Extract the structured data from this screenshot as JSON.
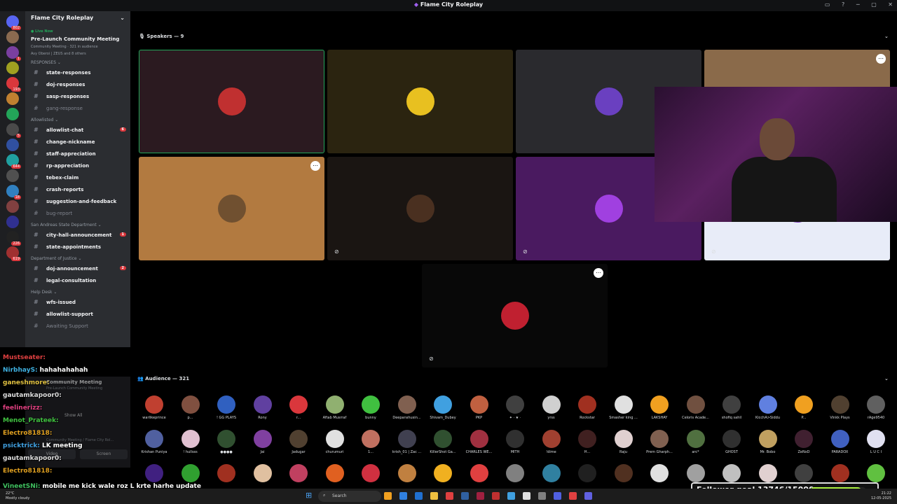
{
  "window": {
    "title": "Flame City Roleplay",
    "controls": [
      "▭",
      "?",
      "─",
      "▢",
      "✕"
    ]
  },
  "guilds": [
    {
      "color": "#5865f2",
      "badge": "802"
    },
    {
      "color": "#8a6a50",
      "badge": ""
    },
    {
      "color": "#7a3fa0",
      "badge": "1"
    },
    {
      "color": "#a0a020",
      "badge": ""
    },
    {
      "color": "#da373c",
      "badge": "193"
    },
    {
      "color": "#c08030",
      "badge": ""
    },
    {
      "color": "#23a559",
      "badge": ""
    },
    {
      "color": "#4a4a4a",
      "badge": "5"
    },
    {
      "color": "#3050a0",
      "badge": ""
    },
    {
      "color": "#20a0a0",
      "badge": "644"
    },
    {
      "color": "#505050",
      "badge": ""
    },
    {
      "color": "#3080c0",
      "badge": "18"
    },
    {
      "color": "#804040",
      "badge": ""
    },
    {
      "color": "#303090",
      "badge": ""
    },
    {
      "color": "#222",
      "badge": "226"
    },
    {
      "color": "#a03030",
      "badge": "619"
    }
  ],
  "server": {
    "name": "Flame City Roleplay",
    "event": {
      "live_label": "Live Now",
      "title": "Pre-Launch Community Meeting",
      "meta": "Community Meeting · 321 in audience",
      "speakers": "Avy Oberoi | ZEUS and 8 others"
    }
  },
  "categories": [
    {
      "name": "RESPONSES",
      "channels": [
        {
          "name": "state-responses",
          "muted": false,
          "count": ""
        },
        {
          "name": "doj-responses",
          "muted": false,
          "count": ""
        },
        {
          "name": "sasp-responses",
          "muted": false,
          "count": ""
        },
        {
          "name": "gang-response",
          "muted": true,
          "count": ""
        }
      ]
    },
    {
      "name": "Allowlisted",
      "channels": [
        {
          "name": "allowlist-chat",
          "muted": false,
          "count": "6"
        },
        {
          "name": "change-nickname",
          "muted": false,
          "count": ""
        },
        {
          "name": "staff-appreciation",
          "muted": false,
          "count": ""
        },
        {
          "name": "rp-appreciation",
          "muted": false,
          "count": ""
        },
        {
          "name": "tebex-claim",
          "muted": false,
          "count": ""
        },
        {
          "name": "crash-reports",
          "muted": false,
          "count": ""
        },
        {
          "name": "suggestion-and-feedback",
          "muted": false,
          "count": ""
        },
        {
          "name": "bug-report",
          "muted": true,
          "count": ""
        }
      ]
    },
    {
      "name": "San Andreas State Department",
      "channels": [
        {
          "name": "city-hall-announcement",
          "muted": false,
          "count": "1"
        },
        {
          "name": "state-appointments",
          "muted": false,
          "count": ""
        }
      ]
    },
    {
      "name": "Department of Justice",
      "channels": [
        {
          "name": "doj-announcement",
          "muted": false,
          "count": "2"
        },
        {
          "name": "legal-consultation",
          "muted": false,
          "count": ""
        }
      ]
    },
    {
      "name": "Help Desk",
      "channels": [
        {
          "name": "wfs-issued",
          "muted": false,
          "count": ""
        },
        {
          "name": "allowlist-support",
          "muted": false,
          "count": ""
        },
        {
          "name": "Awaiting Support",
          "muted": true,
          "count": ""
        }
      ]
    }
  ],
  "chat": [
    {
      "user": "Mustseater:",
      "text": "",
      "color": "#e04040"
    },
    {
      "user": "NirbhayS:",
      "text": "hahahahahah",
      "color": "#3fb0e0"
    },
    {
      "user": "ganeshmore:",
      "text": "",
      "color": "#e0c040"
    },
    {
      "user": "gautamkapoor0:",
      "text": "",
      "color": "#ddd"
    },
    {
      "user": "feelinerizz:",
      "text": "",
      "color": "#e04080"
    },
    {
      "user": "Menot_Prateek:",
      "text": "",
      "color": "#40c040"
    },
    {
      "user": "Electro81818:",
      "text": "",
      "color": "#e0a020"
    },
    {
      "user": "psicktrick:",
      "text": "LK meeting",
      "color": "#40a0e0"
    },
    {
      "user": "gautamkapoor0:",
      "text": "",
      "color": "#ddd"
    },
    {
      "user": "Electro81818:",
      "text": "",
      "color": "#e0a020"
    },
    {
      "user": "VineetSNi:",
      "text": "mobile me kick wale roz L krte harhe update",
      "color": "#40c060"
    }
  ],
  "voice_panel": {
    "title": "Community Meeting",
    "subtitle": "Pre-Launch Community Meeting",
    "show_all": "Show All",
    "location": "Community Meeting / Flame City Rol...",
    "video": "Video",
    "screen": "Screen"
  },
  "stage": {
    "speakers_label": "Speakers — 9",
    "audience_label": "Audience — 321",
    "speakers": [
      {
        "bg": "#2b1a20",
        "av": "#c03030",
        "border": "#23a559",
        "muted": false,
        "opt": false
      },
      {
        "bg": "#2b2410",
        "av": "#e8c020",
        "border": "",
        "muted": false,
        "opt": false
      },
      {
        "bg": "#2a2a2e",
        "av": "#6a40c0",
        "border": "",
        "muted": false,
        "opt": false
      },
      {
        "bg": "#8a6a4a",
        "av": "#8a6a4a",
        "border": "",
        "muted": false,
        "opt": true
      },
      {
        "bg": "#b27a40",
        "av": "#705030",
        "border": "",
        "muted": false,
        "opt": true
      },
      {
        "bg": "#1a1512",
        "av": "#4a3020",
        "border": "",
        "muted": true,
        "opt": false
      },
      {
        "bg": "#4a1a60",
        "av": "#a040e0",
        "border": "",
        "muted": true,
        "opt": false
      },
      {
        "bg": "#e8ecf8",
        "av": "#8040c0",
        "border": "",
        "muted": true,
        "opt": false
      },
      {
        "bg": "#080808",
        "av": "#c02030",
        "border": "",
        "muted": true,
        "opt": true
      }
    ]
  },
  "audience": [
    {
      "name": "warlikeprince",
      "color": "#c04030"
    },
    {
      "name": "p...",
      "color": "#805040"
    },
    {
      "name": "! GG PLAYS",
      "color": "#3060c0"
    },
    {
      "name": "Rony",
      "color": "#6040a0"
    },
    {
      "name": "r...",
      "color": "#da373c"
    },
    {
      "name": "Aftab Musrraf",
      "color": "#90b070"
    },
    {
      "name": "bunny",
      "color": "#40c040"
    },
    {
      "name": "Deepanshusin...",
      "color": "#806050"
    },
    {
      "name": "Shivam_Dubey",
      "color": "#40a0e0"
    },
    {
      "name": "PKP",
      "color": "#c06040"
    },
    {
      "name": "✦ · ★ ·",
      "color": "#404040"
    },
    {
      "name": "yrss",
      "color": "#d0d0d0"
    },
    {
      "name": "Rockstar",
      "color": "#a03020"
    },
    {
      "name": "Smasher king ...",
      "color": "#e0e0e0"
    },
    {
      "name": "LAKSHAY",
      "color": "#f0a020"
    },
    {
      "name": "Celoris Acade...",
      "color": "#705040"
    },
    {
      "name": "shofiq sahil",
      "color": "#404040"
    },
    {
      "name": "KicchA>Siddu",
      "color": "#6080e0"
    },
    {
      "name": "P...",
      "color": "#f0a020"
    },
    {
      "name": "Vinkk Plays",
      "color": "#504030"
    },
    {
      "name": "rAge9540",
      "color": "#606060"
    },
    {
      "name": "Krishan Puniya",
      "color": "#5060a0"
    },
    {
      "name": "! hullsss",
      "color": "#e0c0d0"
    },
    {
      "name": "●●●●",
      "color": "#305030"
    },
    {
      "name": "Jai",
      "color": "#8040a0"
    },
    {
      "name": "Jadugar",
      "color": "#504030"
    },
    {
      "name": "churumuri",
      "color": "#e0e0e0"
    },
    {
      "name": "1...",
      "color": "#c07060"
    },
    {
      "name": "krish_01 | Zac ...",
      "color": "#404050"
    },
    {
      "name": "KillerShot Ga...",
      "color": "#305030"
    },
    {
      "name": "CHARLES WE...",
      "color": "#a03040"
    },
    {
      "name": "MITH",
      "color": "#303030"
    },
    {
      "name": "!dime",
      "color": "#a04030"
    },
    {
      "name": "H...",
      "color": "#402020"
    },
    {
      "name": "Raju",
      "color": "#e0d0d0"
    },
    {
      "name": "Prem Gharph...",
      "color": "#806050"
    },
    {
      "name": "arc*",
      "color": "#507040"
    },
    {
      "name": "GHOST",
      "color": "#303030"
    },
    {
      "name": "Mr. Bobo",
      "color": "#c0a060"
    },
    {
      "name": "ZeNxD",
      "color": "#402030"
    },
    {
      "name": "PARADOX",
      "color": "#4060c0"
    },
    {
      "name": "L U C I",
      "color": "#e0e0f0"
    },
    {
      "name": "",
      "color": "#402080"
    },
    {
      "name": "",
      "color": "#30a030"
    },
    {
      "name": "",
      "color": "#a03020"
    },
    {
      "name": "",
      "color": "#e0c0a0"
    },
    {
      "name": "",
      "color": "#c04060"
    },
    {
      "name": "",
      "color": "#e06020"
    },
    {
      "name": "",
      "color": "#d03040"
    },
    {
      "name": "",
      "color": "#c08040"
    },
    {
      "name": "",
      "color": "#f0b020"
    },
    {
      "name": "",
      "color": "#e04040"
    },
    {
      "name": "",
      "color": "#808080"
    },
    {
      "name": "",
      "color": "#3080a0"
    },
    {
      "name": "",
      "color": "#202020"
    },
    {
      "name": "",
      "color": "#503020"
    },
    {
      "name": "",
      "color": "#e0e0e0"
    },
    {
      "name": "",
      "color": "#a0a0a0"
    },
    {
      "name": "",
      "color": "#c0c0c0"
    },
    {
      "name": "",
      "color": "#e0d0d0"
    },
    {
      "name": "",
      "color": "#404040"
    },
    {
      "name": "",
      "color": "#a03020"
    },
    {
      "name": "",
      "color": "#60c040"
    }
  ],
  "overlay": {
    "follower_label": "Follower goal 13746/15000",
    "follower_progress": 0.9164
  },
  "taskbar": {
    "temp": "22°C",
    "weather": "Mostly cloudy",
    "search": "Search",
    "time": "21:22",
    "date": "12-05-2025",
    "icons": [
      "#f0a020",
      "#3080e0",
      "#2070d0",
      "#f0c040",
      "#e04040",
      "#3060a0",
      "#a02040",
      "#c03030",
      "#40a0e0",
      "#e0e0e0",
      "#808080",
      "#5060e0",
      "#e04040",
      "#6060e0"
    ]
  }
}
